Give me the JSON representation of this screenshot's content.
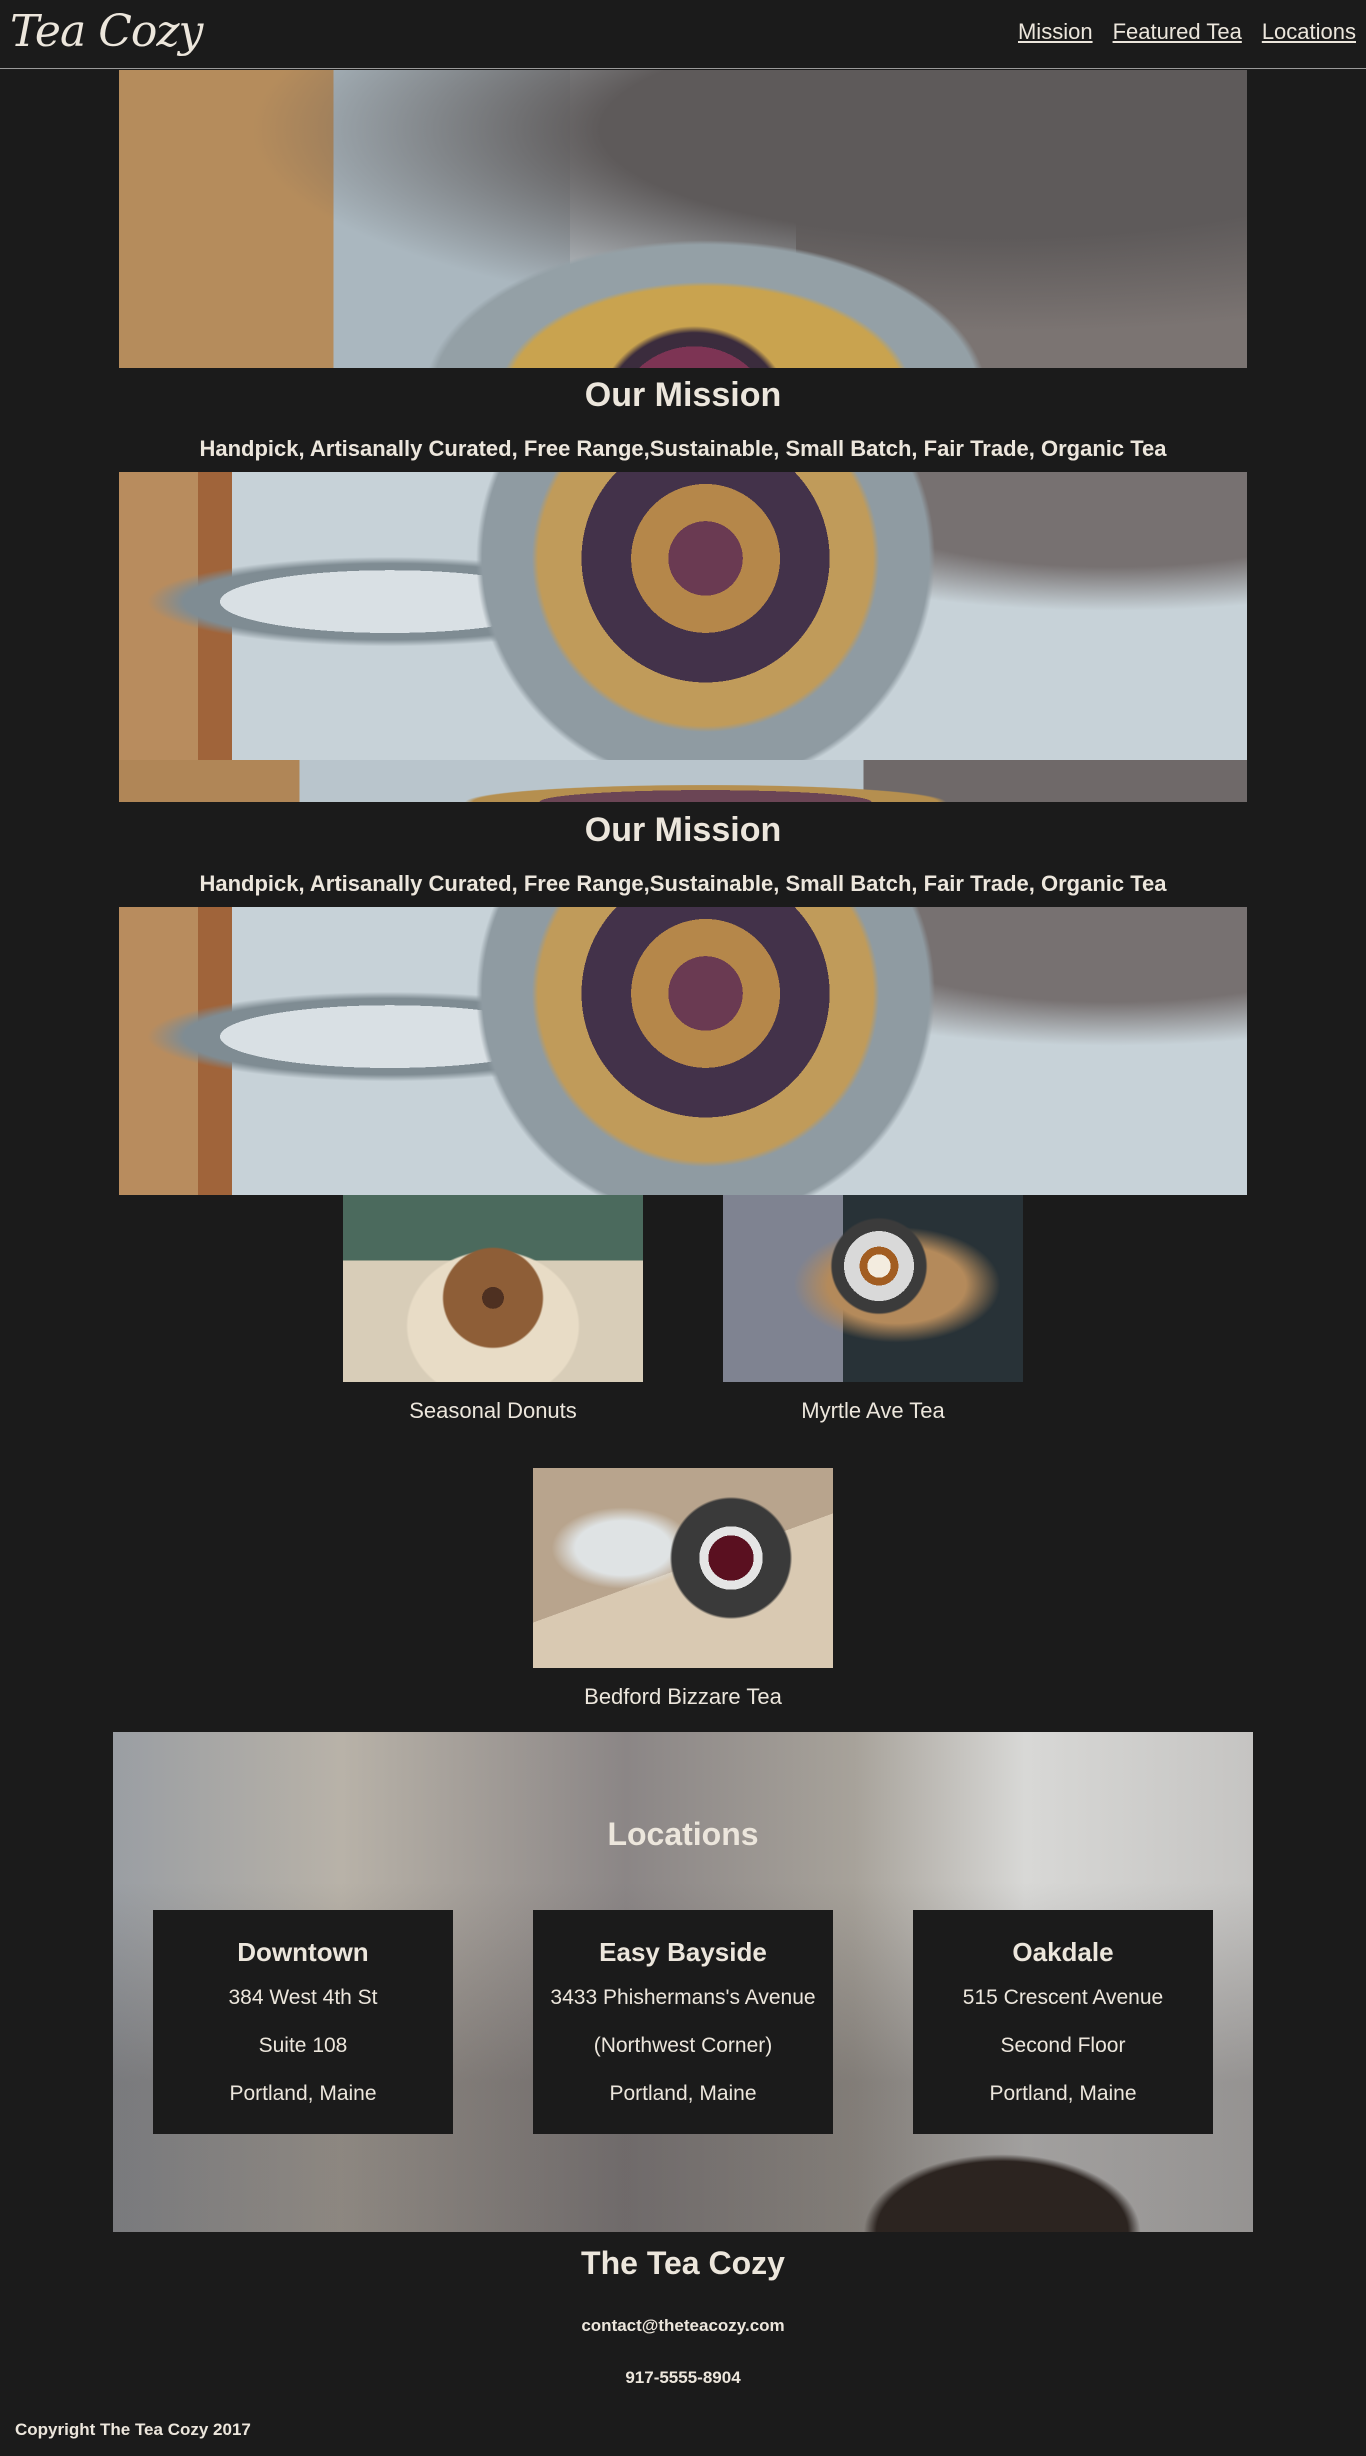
{
  "header": {
    "logo": "Tea Cozy",
    "nav": [
      "Mission",
      "Featured Tea",
      "Locations"
    ]
  },
  "mission": [
    {
      "title": "Our Mission",
      "subtitle": "Handpick, Artisanally Curated, Free Range,Sustainable, Small Batch, Fair Trade, Organic Tea"
    },
    {
      "title": "Our Mission",
      "subtitle": "Handpick, Artisanally Curated, Free Range,Sustainable, Small Batch, Fair Trade, Organic Tea"
    }
  ],
  "featured": [
    {
      "caption": "Seasonal Donuts",
      "image": "donut-photo"
    },
    {
      "caption": "Myrtle Ave Tea",
      "image": "tea-cup-photo"
    },
    {
      "caption": "Bedford Bizzare Tea",
      "image": "red-tea-photo"
    }
  ],
  "locations": {
    "title": "Locations",
    "stores": [
      {
        "name": "Downtown",
        "lines": [
          "384 West 4th St",
          "Suite 108",
          "Portland, Maine"
        ]
      },
      {
        "name": "Easy Bayside",
        "lines": [
          "3433 Phishermans's Avenue",
          "(Northwest Corner)",
          "Portland, Maine"
        ]
      },
      {
        "name": "Oakdale",
        "lines": [
          "515 Crescent Avenue",
          "Second Floor",
          "Portland, Maine"
        ]
      }
    ]
  },
  "footer": {
    "title": "The Tea Cozy",
    "email": "contact@theteacozy.com",
    "phone": "917-5555-8904",
    "copyright": "Copyright The Tea Cozy 2017"
  },
  "colors": {
    "background": "#1b1b1b",
    "text": "#ece6dc"
  }
}
